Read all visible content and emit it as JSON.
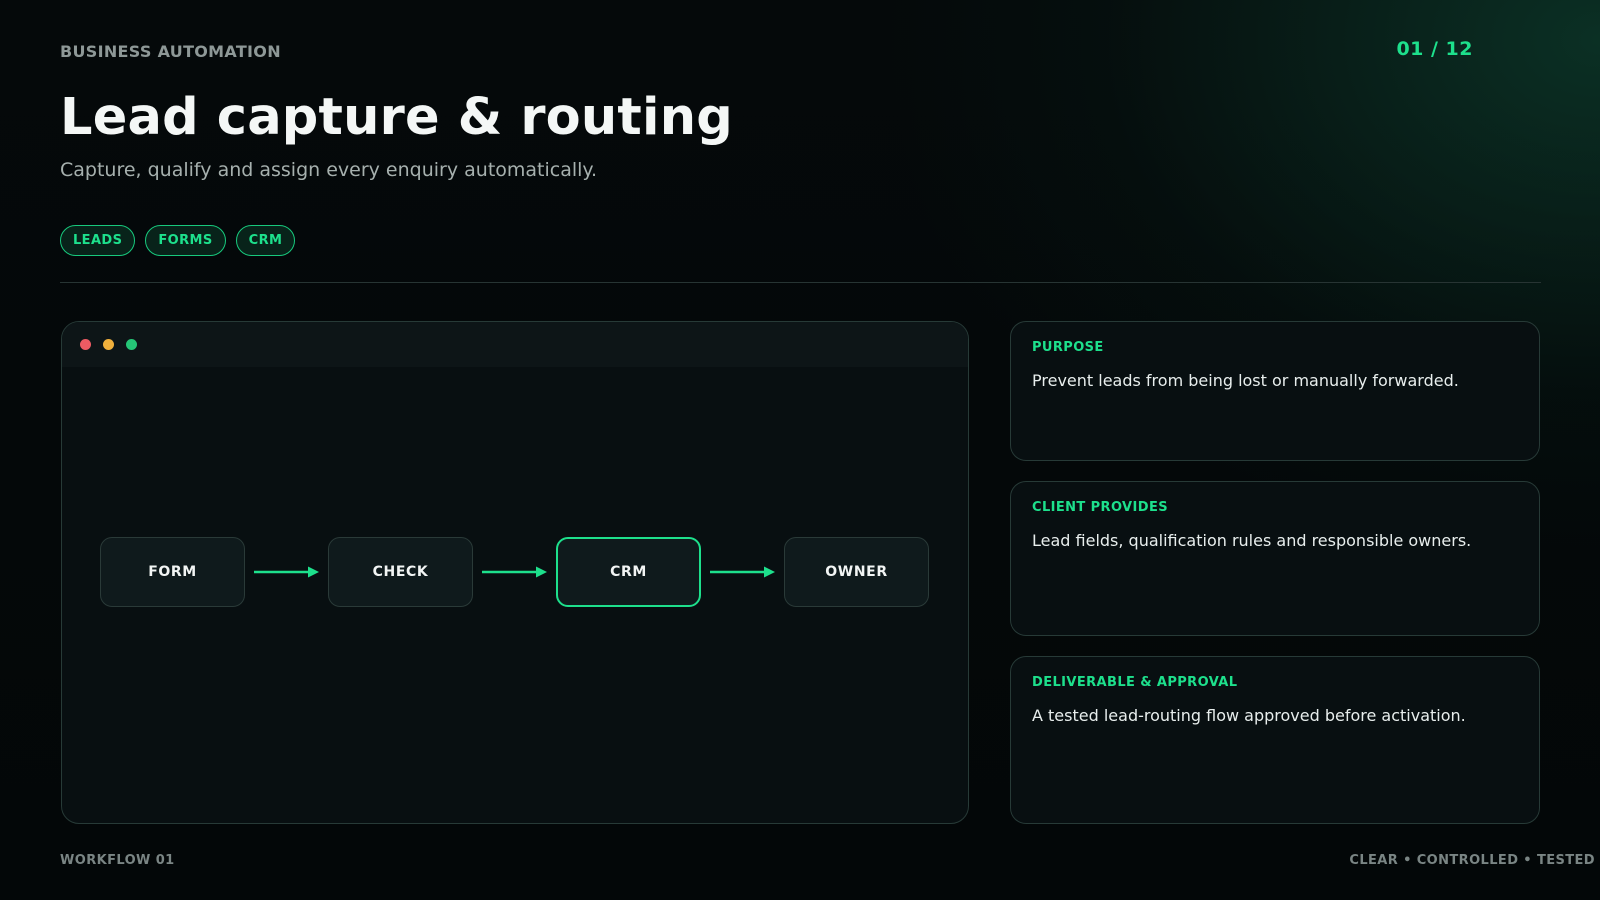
{
  "header": {
    "eyebrow": "BUSINESS AUTOMATION",
    "page_counter": "01 / 12",
    "title": "Lead capture & routing",
    "subtitle": "Capture, qualify and assign every enquiry automatically."
  },
  "tags": [
    "LEADS",
    "FORMS",
    "CRM"
  ],
  "window": {
    "controls": [
      "close",
      "minimize",
      "maximize"
    ]
  },
  "flow": {
    "nodes": [
      {
        "label": "FORM",
        "active": false
      },
      {
        "label": "CHECK",
        "active": false
      },
      {
        "label": "CRM",
        "active": true
      },
      {
        "label": "OWNER",
        "active": false
      }
    ]
  },
  "cards": [
    {
      "label": "PURPOSE",
      "text": "Prevent leads from being lost or manually forwarded."
    },
    {
      "label": "CLIENT PROVIDES",
      "text": "Lead fields, qualification rules and responsible owners."
    },
    {
      "label": "DELIVERABLE & APPROVAL",
      "text": "A tested lead-routing flow approved before activation."
    }
  ],
  "footer": {
    "left": "WORKFLOW 01",
    "right": "CLEAR • CONTROLLED • TESTED"
  },
  "colors": {
    "accent": "#1de08c",
    "background": "#030708",
    "panel": "#080f11",
    "window_close": "#ed5b63",
    "window_minimize": "#f0b03c",
    "window_maximize": "#25c576"
  }
}
